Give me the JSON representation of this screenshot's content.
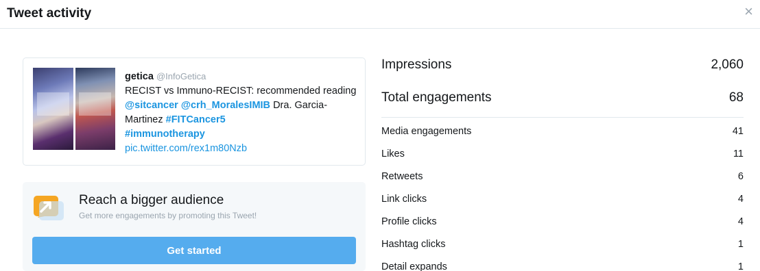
{
  "header": {
    "title": "Tweet activity",
    "close_glyph": "×"
  },
  "tweet": {
    "name": "getica",
    "handle": "@InfoGetica",
    "text_1": "RECIST vs Immuno-RECIST: recommended reading ",
    "mention_1": "@sitcancer",
    "mention_2": "@crh_MoralesIMIB",
    "text_2": " Dra. Garcia-Martinez ",
    "hashtag_1": "#FITCancer5",
    "hashtag_2": "#immunotherapy",
    "link": "pic.twitter.com/rex1m80Nzb"
  },
  "promo": {
    "title": "Reach a bigger audience",
    "subtitle": "Get more engagements by promoting this Tweet!",
    "button": "Get started",
    "icon": "promote-arrow-icon",
    "icon_color": "#f5a623"
  },
  "metrics": {
    "impressions_label": "Impressions",
    "impressions_value": "2,060",
    "engagements_label": "Total engagements",
    "engagements_value": "68",
    "rows": [
      {
        "label": "Media engagements",
        "value": "41"
      },
      {
        "label": "Likes",
        "value": "11"
      },
      {
        "label": "Retweets",
        "value": "6"
      },
      {
        "label": "Link clicks",
        "value": "4"
      },
      {
        "label": "Profile clicks",
        "value": "4"
      },
      {
        "label": "Hashtag clicks",
        "value": "1"
      },
      {
        "label": "Detail expands",
        "value": "1"
      }
    ]
  },
  "colors": {
    "link": "#1b95e0",
    "button": "#55acee",
    "muted": "#9aa5af"
  }
}
